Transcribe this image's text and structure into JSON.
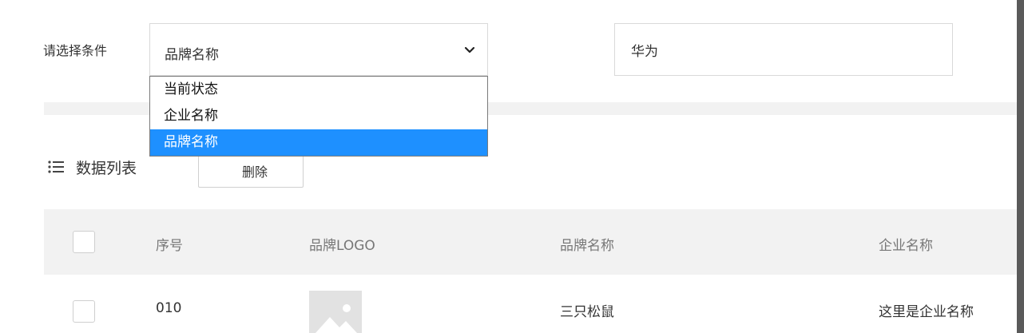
{
  "filter": {
    "label": "请选择条件",
    "selected": "品牌名称",
    "options": [
      "当前状态",
      "企业名称",
      "品牌名称"
    ],
    "selected_index": 2
  },
  "search": {
    "value": "华为"
  },
  "list": {
    "title": "数据列表",
    "delete_label": "删除"
  },
  "table": {
    "headers": [
      "序号",
      "品牌LOGO",
      "品牌名称",
      "企业名称"
    ],
    "rows": [
      {
        "index": "010",
        "brand": "三只松鼠",
        "company": "这里是企业名称"
      }
    ]
  },
  "colors": {
    "accent": "#1e90ff",
    "header_bg": "#f2f2f2",
    "border": "#d9d9d9"
  },
  "icons": [
    "chevron-down-icon",
    "list-icon",
    "image-placeholder-icon"
  ]
}
